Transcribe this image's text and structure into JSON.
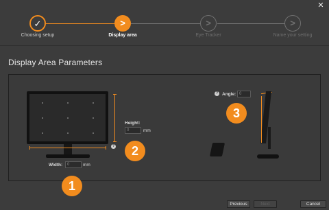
{
  "window": {
    "close_symbol": "✕"
  },
  "stepper": {
    "steps": [
      {
        "label": "Choosing setup",
        "symbol": "✓",
        "state": "completed"
      },
      {
        "label": "Display area",
        "symbol": ">",
        "state": "current"
      },
      {
        "label": "Eye Tracker",
        "symbol": ">",
        "state": "pending"
      },
      {
        "label": "Name your setting",
        "symbol": ">",
        "state": "pending"
      }
    ]
  },
  "section": {
    "title": "Display Area Parameters"
  },
  "fields": {
    "height": {
      "label": "Height:",
      "value": "0",
      "unit": "mm"
    },
    "width": {
      "label": "Width:",
      "value": "0",
      "unit": "mm"
    },
    "angle": {
      "label": "Angle:",
      "value": "0"
    }
  },
  "help_symbol": "?",
  "badges": [
    "1",
    "2",
    "3"
  ],
  "buttons": {
    "previous": "Previous",
    "next": "Next",
    "cancel": "Cancel"
  },
  "colors": {
    "accent": "#f28c1e",
    "background": "#3c3c3c"
  },
  "icons": [
    "close-icon",
    "checkmark-icon",
    "arrow-right-icon",
    "help-icon",
    "monitor-icon",
    "eye-tracker-icon"
  ]
}
